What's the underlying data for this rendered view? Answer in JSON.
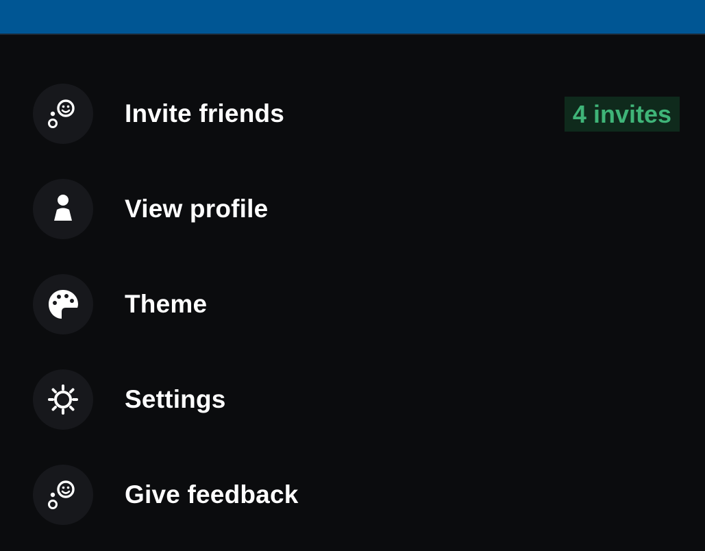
{
  "colors": {
    "topbar": "#005694",
    "background": "#0b0c0e",
    "icon_circle": "#17181c",
    "badge_bg": "#0f2a1c",
    "badge_text": "#3fb478"
  },
  "menu": {
    "items": [
      {
        "label": "Invite friends",
        "icon": "invite-icon",
        "badge": "4 invites"
      },
      {
        "label": "View profile",
        "icon": "person-icon"
      },
      {
        "label": "Theme",
        "icon": "palette-icon"
      },
      {
        "label": "Settings",
        "icon": "gear-icon"
      },
      {
        "label": "Give feedback",
        "icon": "feedback-icon"
      }
    ]
  }
}
